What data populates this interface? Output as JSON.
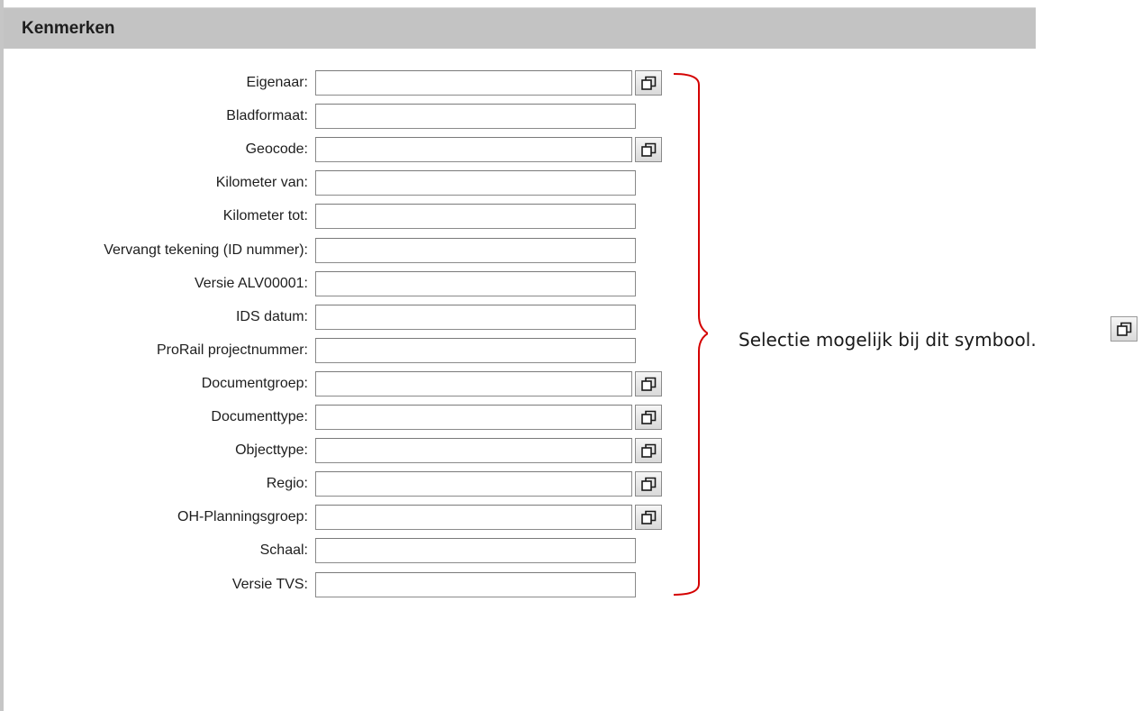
{
  "panel": {
    "title": "Kenmerken"
  },
  "fields": [
    {
      "label": "Eigenaar:",
      "value": "",
      "has_select": true
    },
    {
      "label": "Bladformaat:",
      "value": "",
      "has_select": false
    },
    {
      "label": "Geocode:",
      "value": "",
      "has_select": true
    },
    {
      "label": "Kilometer van:",
      "value": "",
      "has_select": false
    },
    {
      "label": "Kilometer tot:",
      "value": "",
      "has_select": false
    },
    {
      "label": "Vervangt tekening (ID nummer):",
      "value": "",
      "has_select": false
    },
    {
      "label": "Versie ALV00001:",
      "value": "",
      "has_select": false
    },
    {
      "label": "IDS datum:",
      "value": "",
      "has_select": false
    },
    {
      "label": "ProRail projectnummer:",
      "value": "",
      "has_select": false
    },
    {
      "label": "Documentgroep:",
      "value": "",
      "has_select": true
    },
    {
      "label": "Documenttype:",
      "value": "",
      "has_select": true
    },
    {
      "label": "Objecttype:",
      "value": "",
      "has_select": true
    },
    {
      "label": "Regio:",
      "value": "",
      "has_select": true
    },
    {
      "label": "OH-Planningsgroep:",
      "value": "",
      "has_select": true
    },
    {
      "label": "Schaal:",
      "value": "",
      "has_select": false
    },
    {
      "label": "Versie TVS:",
      "value": "",
      "has_select": false
    }
  ],
  "legend": {
    "text": "Selectie mogelijk bij dit symbool.",
    "symbol_icon": "selection-window-icon",
    "bracket_color": "#d40000"
  },
  "colors": {
    "header_bg": "#c3c3c3",
    "field_border": "#8a8a8a"
  }
}
